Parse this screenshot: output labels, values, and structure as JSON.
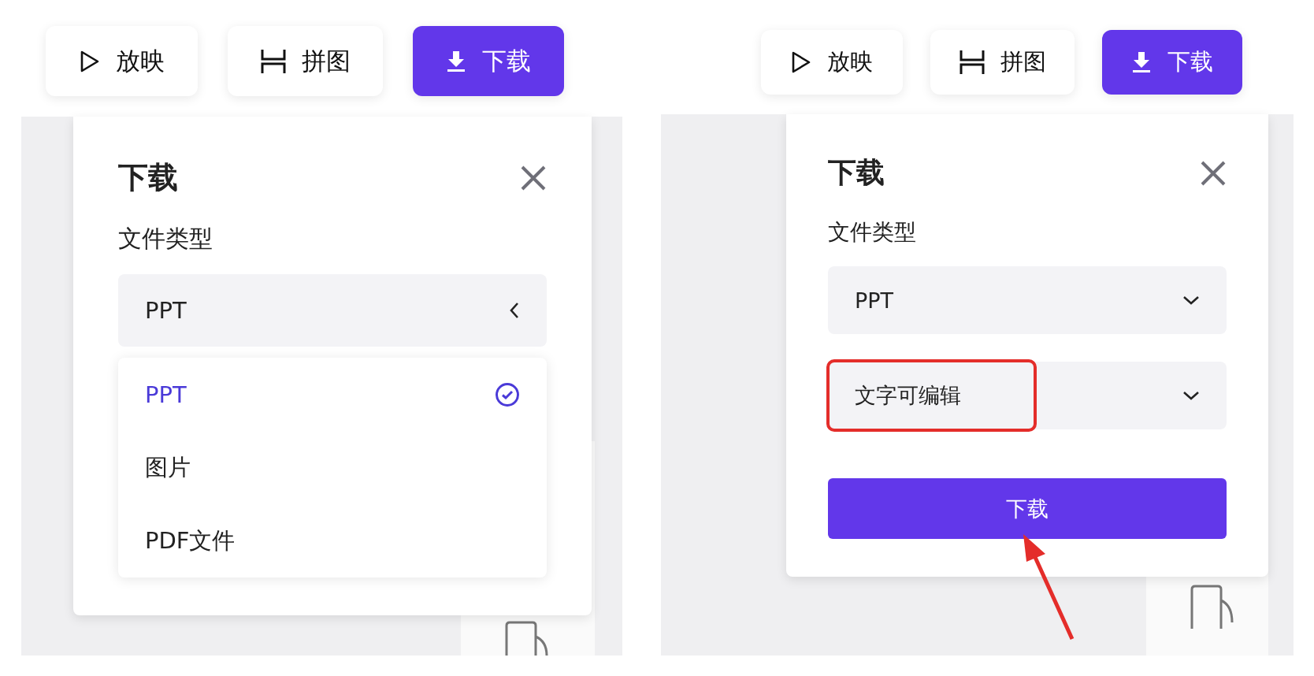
{
  "panels": [
    {
      "toolbar": [
        {
          "label": "放映",
          "kind": "play",
          "primary": false
        },
        {
          "label": "拼图",
          "kind": "collage",
          "primary": false
        },
        {
          "label": "下载",
          "kind": "download",
          "primary": true
        }
      ],
      "dialog": {
        "title": "下载",
        "field_label": "文件类型",
        "selects": [
          {
            "value": "PPT",
            "expanded": true,
            "highlighted": false
          }
        ],
        "menu": [
          {
            "label": "PPT",
            "selected": true
          },
          {
            "label": "图片",
            "selected": false
          },
          {
            "label": "PDF文件",
            "selected": false
          }
        ]
      }
    },
    {
      "toolbar": [
        {
          "label": "放映",
          "kind": "play",
          "primary": false
        },
        {
          "label": "拼图",
          "kind": "collage",
          "primary": false
        },
        {
          "label": "下载",
          "kind": "download",
          "primary": true
        }
      ],
      "dialog": {
        "title": "下载",
        "field_label": "文件类型",
        "selects": [
          {
            "value": "PPT",
            "expanded": false,
            "highlighted": false
          },
          {
            "value": "文字可编辑",
            "expanded": false,
            "highlighted": true
          }
        ],
        "download_button": "下载"
      },
      "callout_arrow": true
    }
  ]
}
